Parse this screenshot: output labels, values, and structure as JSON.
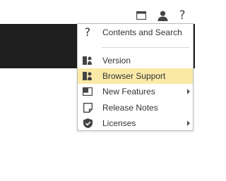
{
  "header": {
    "icons": [
      "window-icon",
      "user-icon",
      "help-icon"
    ],
    "help_glyph": "?"
  },
  "menu": {
    "items": [
      {
        "label": "Contents and Search",
        "icon": "help-icon",
        "submenu": false,
        "highlighted": false
      },
      {
        "label": "Version",
        "icon": "version-icon",
        "submenu": false,
        "highlighted": false
      },
      {
        "label": "Browser Support",
        "icon": "browser-support-icon",
        "submenu": false,
        "highlighted": true
      },
      {
        "label": "New Features",
        "icon": "new-features-icon",
        "submenu": true,
        "highlighted": false
      },
      {
        "label": "Release Notes",
        "icon": "release-notes-icon",
        "submenu": false,
        "highlighted": false
      },
      {
        "label": "Licenses",
        "icon": "shield-check-icon",
        "submenu": true,
        "highlighted": false
      }
    ],
    "help_glyph": "?"
  },
  "colors": {
    "dark_bar": "#1e1e1e",
    "highlight": "#fbe9a7",
    "icon": "#444444"
  }
}
